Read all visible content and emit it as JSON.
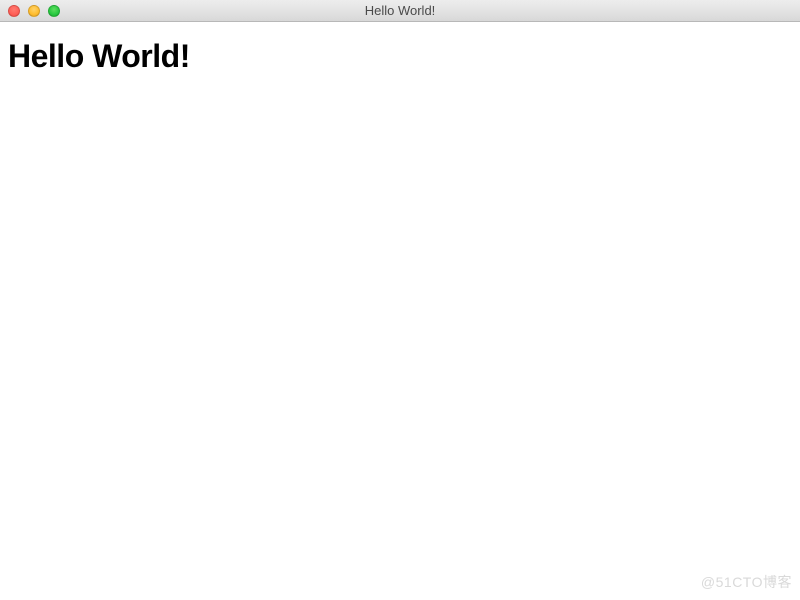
{
  "title_bar": {
    "window_title": "Hello World!",
    "traffic_lights": {
      "close": "close-icon",
      "minimize": "minimize-icon",
      "maximize": "maximize-icon"
    }
  },
  "content": {
    "heading": "Hello World!"
  },
  "watermark": "@51CTO博客"
}
